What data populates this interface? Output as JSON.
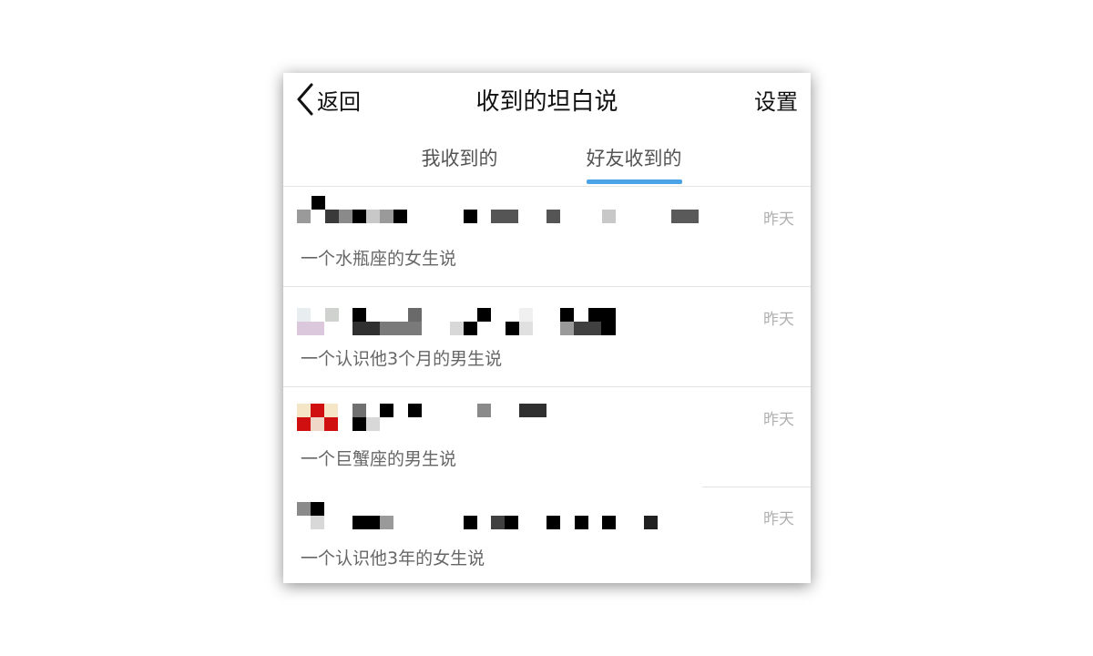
{
  "navbar": {
    "back_label": "返回",
    "title": "收到的坦白说",
    "settings_label": "设置"
  },
  "tabs": [
    {
      "label": "我收到的",
      "active": false
    },
    {
      "label": "好友收到的",
      "active": true
    }
  ],
  "colors": {
    "accent": "#4aa3e6",
    "text_primary": "#111111",
    "text_secondary": "#666666",
    "time": "#b0b0b0"
  },
  "messages": [
    {
      "time": "昨天",
      "sender": "一个水瓶座的女生说",
      "content": "pixelated"
    },
    {
      "time": "昨天",
      "sender": "一个认识他3个月的男生说",
      "content": "pixelated"
    },
    {
      "time": "昨天",
      "sender": "一个巨蟹座的男生说",
      "content": "pixelated"
    },
    {
      "time": "昨天",
      "sender": "一个认识他3年的女生说",
      "content": "pixelated"
    }
  ]
}
